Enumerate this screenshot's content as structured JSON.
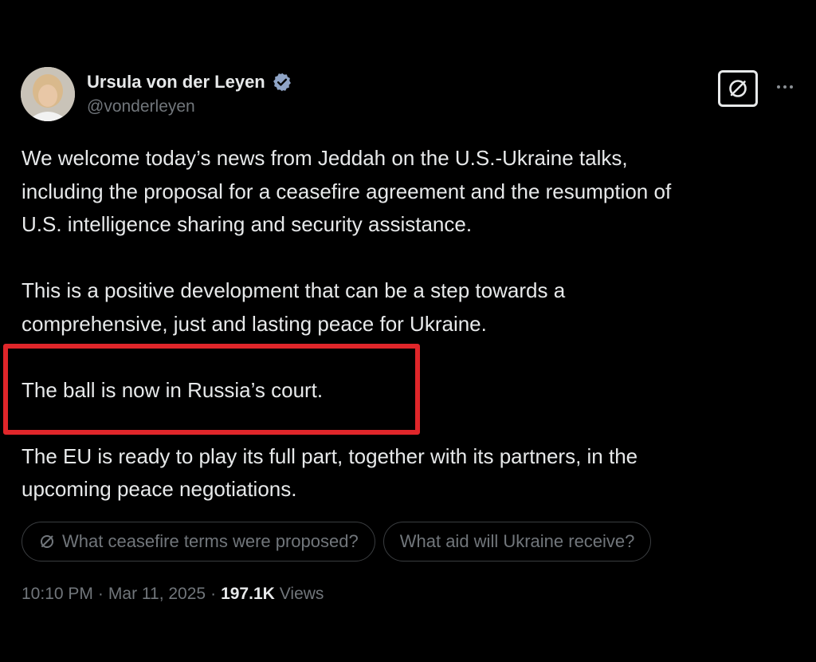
{
  "author": {
    "name": "Ursula von der Leyen",
    "handle": "@vonderleyen",
    "verified": true,
    "verified_color": "#8fa4c6"
  },
  "header_actions": {
    "grok_icon": "grok-slash-circle-icon",
    "more_icon": "more-horizontal-icon"
  },
  "tweet": {
    "paragraphs": [
      "We welcome today’s news from Jeddah on the U.S.-Ukraine talks,\nincluding the proposal for a ceasefire agreement and the resumption of\nU.S. intelligence sharing and security assistance.",
      "This is a positive development that can be a step towards a\ncomprehensive, just and lasting peace for Ukraine.",
      "The ball is now in Russia’s court.",
      "The EU is ready to play its full part, together with its partners, in the\nupcoming peace negotiations."
    ],
    "highlight_color": "#e0262a"
  },
  "suggestions": [
    {
      "label": "What ceasefire terms were proposed?",
      "icon": "grok-slash-circle-icon"
    },
    {
      "label": "What aid will Ukraine receive?"
    }
  ],
  "meta": {
    "time": "10:10 PM",
    "separator": "·",
    "date": "Mar 11, 2025",
    "views_count": "197.1K",
    "views_label": "Views"
  },
  "colors": {
    "background": "#000000",
    "text_primary": "#e7e9ea",
    "text_secondary": "#71767b"
  }
}
